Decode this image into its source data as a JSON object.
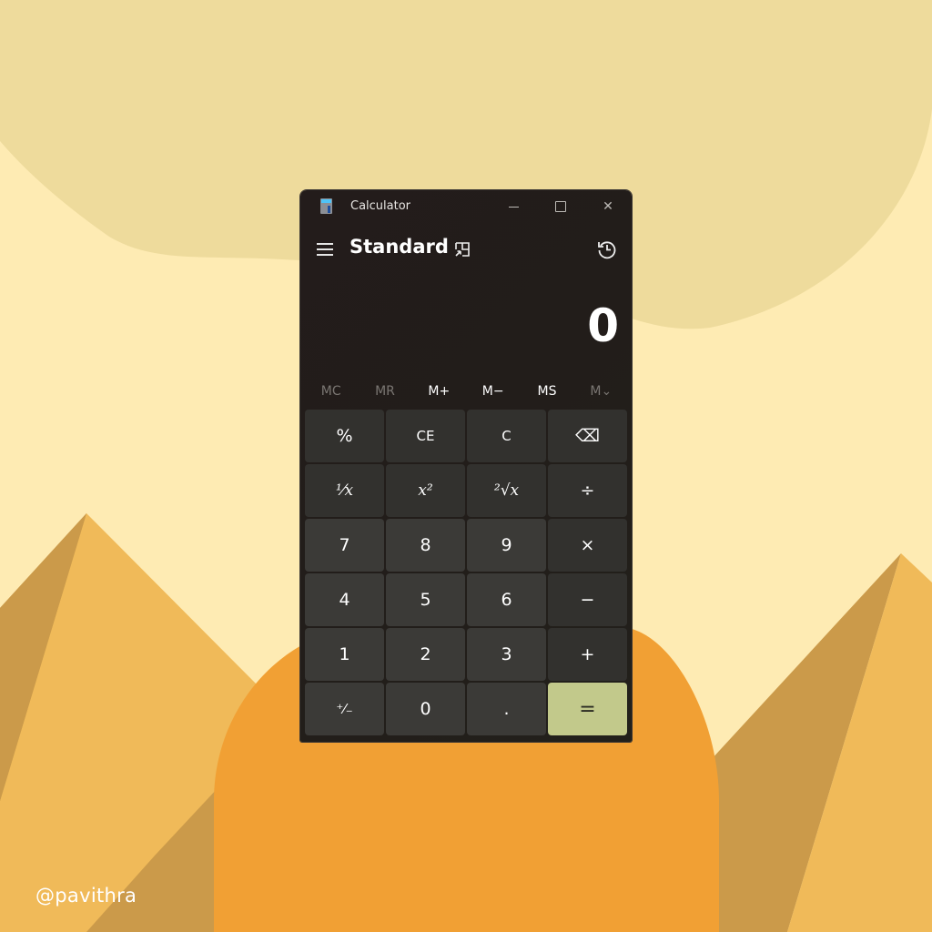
{
  "background": {
    "colors": {
      "sky": "#feebb3",
      "cloud": "#eedb9c",
      "pyramid_light": "#f0ba59",
      "pyramid_shadow": "#cb9a4a",
      "sun": "#f1a034"
    },
    "watermark": "@pavithra"
  },
  "window": {
    "title": "Calculator",
    "controls": {
      "minimize": "minimize",
      "maximize": "maximize",
      "close": "✕"
    }
  },
  "header": {
    "mode": "Standard"
  },
  "display": {
    "value": "0"
  },
  "memory": [
    {
      "label": "MC",
      "enabled": false
    },
    {
      "label": "MR",
      "enabled": false
    },
    {
      "label": "M+",
      "enabled": true
    },
    {
      "label": "M−",
      "enabled": true
    },
    {
      "label": "MS",
      "enabled": true
    },
    {
      "label": "M⌄",
      "enabled": false
    }
  ],
  "keys": [
    {
      "label": "%",
      "name": "percent-button",
      "type": "op"
    },
    {
      "label": "CE",
      "name": "clear-entry-button",
      "type": "op"
    },
    {
      "label": "C",
      "name": "clear-button",
      "type": "op"
    },
    {
      "label": "⌫",
      "name": "backspace-button",
      "type": "op"
    },
    {
      "label": "¹⁄x",
      "name": "reciprocal-button",
      "type": "op"
    },
    {
      "label": "x²",
      "name": "square-button",
      "type": "op"
    },
    {
      "label": "²√x",
      "name": "square-root-button",
      "type": "op"
    },
    {
      "label": "÷",
      "name": "divide-button",
      "type": "op"
    },
    {
      "label": "7",
      "name": "digit-7-button",
      "type": "num"
    },
    {
      "label": "8",
      "name": "digit-8-button",
      "type": "num"
    },
    {
      "label": "9",
      "name": "digit-9-button",
      "type": "num"
    },
    {
      "label": "×",
      "name": "multiply-button",
      "type": "op"
    },
    {
      "label": "4",
      "name": "digit-4-button",
      "type": "num"
    },
    {
      "label": "5",
      "name": "digit-5-button",
      "type": "num"
    },
    {
      "label": "6",
      "name": "digit-6-button",
      "type": "num"
    },
    {
      "label": "−",
      "name": "subtract-button",
      "type": "op"
    },
    {
      "label": "1",
      "name": "digit-1-button",
      "type": "num"
    },
    {
      "label": "2",
      "name": "digit-2-button",
      "type": "num"
    },
    {
      "label": "3",
      "name": "digit-3-button",
      "type": "num"
    },
    {
      "label": "+",
      "name": "add-button",
      "type": "op"
    },
    {
      "label": "⁺⁄₋",
      "name": "negate-button",
      "type": "num"
    },
    {
      "label": "0",
      "name": "digit-0-button",
      "type": "num"
    },
    {
      "label": ".",
      "name": "decimal-button",
      "type": "num"
    },
    {
      "label": "=",
      "name": "equals-button",
      "type": "eq"
    }
  ],
  "accent_color": "#c2c98b"
}
